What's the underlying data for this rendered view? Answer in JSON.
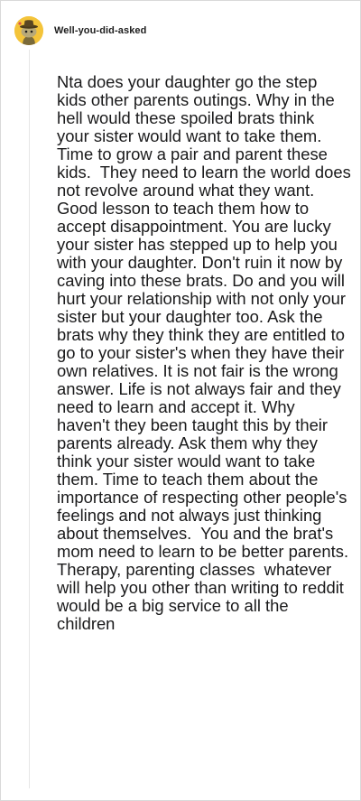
{
  "comment": {
    "author": {
      "username": "Well-you-did-asked",
      "avatar_icon": "snoo-avatar-icon",
      "avatar_color": "#f4c43a"
    },
    "body": "Nta does your daughter go the step kids other parents outings. Why in the hell would these spoiled brats think your sister would want to take them.  Time to grow a pair and parent these kids.  They need to learn the world does not revolve around what they want.  Good lesson to teach them how to accept disappointment. You are lucky your sister has stepped up to help you with your daughter. Don't ruin it now by caving into these brats. Do and you will hurt your relationship with not only your sister but your daughter too. Ask the brats why they think they are entitled to go to your sister's when they have their own relatives. It is not fair is the wrong answer. Life is not always fair and they need to learn and accept it. Why haven't they been taught this by their parents already. Ask them why they think your sister would want to take them. Time to teach them about the importance of respecting other people's feelings and not always just thinking about themselves.  You and the brat's mom need to learn to be better parents.  Therapy, parenting classes  whatever will help you other than writing to reddit would be a big service to all the children"
  }
}
